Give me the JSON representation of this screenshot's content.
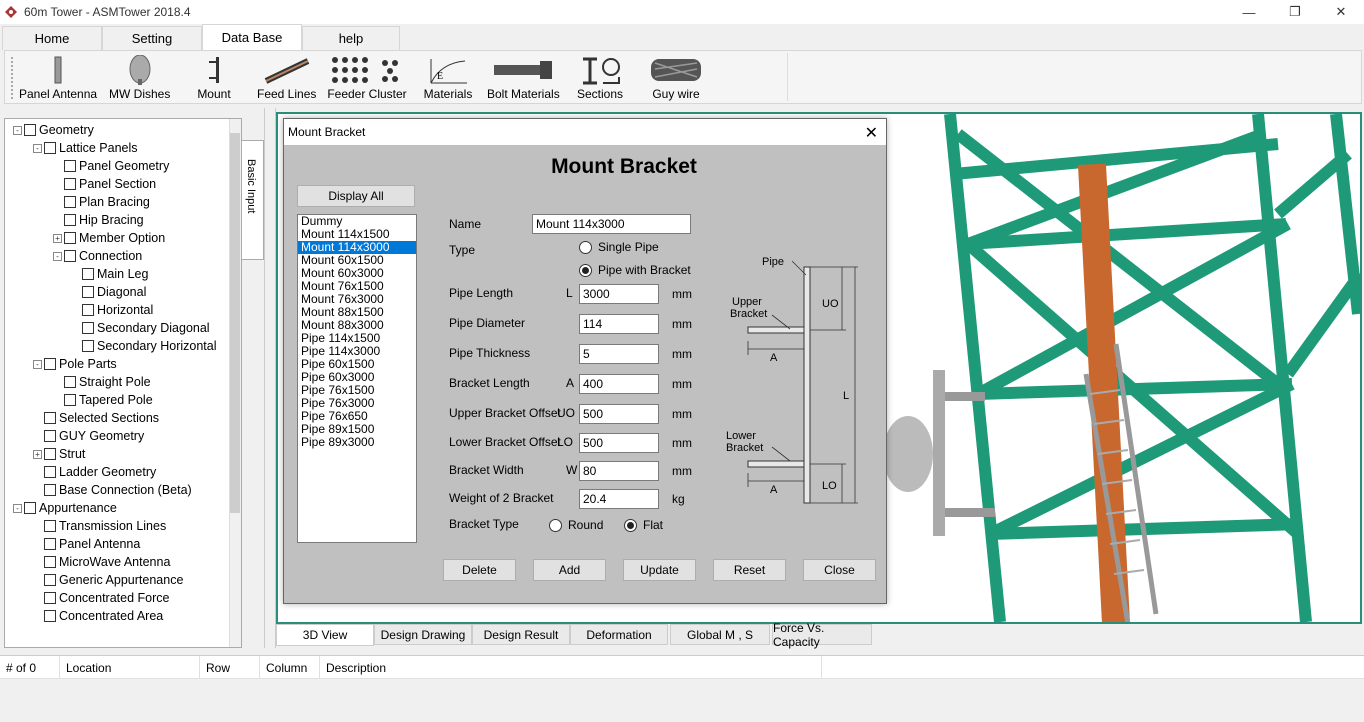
{
  "window": {
    "title": "60m  Tower - ASMTower 2018.4"
  },
  "ribbon_tabs": [
    "Home",
    "Setting",
    "Data Base",
    "help"
  ],
  "ribbon_items": [
    "Panel Antenna",
    "MW Dishes",
    "Mount",
    "Feed Lines",
    "Feeder Cluster",
    "Materials",
    "Bolt Materials",
    "Sections",
    "Guy wire"
  ],
  "tree": {
    "nodes": [
      "Geometry",
      "Lattice Panels",
      "Panel Geometry",
      "Panel Section",
      "Plan Bracing",
      "Hip Bracing",
      "Member Option",
      "Connection",
      "Main Leg",
      "Diagonal",
      "Horizontal",
      "Secondary Diagonal",
      "Secondary Horizontal",
      "Pole Parts",
      "Straight Pole",
      "Tapered Pole",
      "Selected Sections",
      "GUY Geometry",
      "Strut",
      "Ladder Geometry",
      "Base Connection (Beta)",
      "Appurtenance",
      "Transmission Lines",
      "Panel Antenna",
      "MicroWave Antenna",
      "Generic Appurtenance",
      "Concentrated Force",
      "Concentrated Area"
    ],
    "side_tab": "Basic Input"
  },
  "view_tabs": [
    "3D View",
    "Design Drawing",
    "Design Result",
    "Deformation",
    "Global M , S",
    "Force Vs. Capacity"
  ],
  "grid_headers": [
    "# of 0",
    "Location",
    "Row",
    "Column",
    "Description"
  ],
  "dialog": {
    "title": "Mount Bracket",
    "heading": "Mount Bracket",
    "display_all": "Display All",
    "list": [
      "Dummy",
      "Mount 114x1500",
      "Mount 114x3000",
      "Mount 60x1500",
      "Mount 60x3000",
      "Mount 76x1500",
      "Mount 76x3000",
      "Mount 88x1500",
      "Mount 88x3000",
      "Pipe 114x1500",
      "Pipe 114x3000",
      "Pipe 60x1500",
      "Pipe 60x3000",
      "Pipe 76x1500",
      "Pipe 76x3000",
      "Pipe 76x650",
      "Pipe 89x1500",
      "Pipe 89x3000"
    ],
    "selected_index": 2,
    "name_label": "Name",
    "name_value": "Mount 114x3000",
    "type_label": "Type",
    "type_options": [
      "Single Pipe",
      "Pipe with Bracket"
    ],
    "type_selected": "Pipe with Bracket",
    "fields": [
      {
        "label": "Pipe Length",
        "sym": "L",
        "value": "3000",
        "unit": "mm"
      },
      {
        "label": "Pipe Diameter",
        "sym": "",
        "value": "114",
        "unit": "mm"
      },
      {
        "label": "Pipe Thickness",
        "sym": "",
        "value": "5",
        "unit": "mm"
      },
      {
        "label": "Bracket Length",
        "sym": "A",
        "value": "400",
        "unit": "mm"
      },
      {
        "label": "Upper Bracket Offset",
        "sym": "UO",
        "value": "500",
        "unit": "mm"
      },
      {
        "label": "Lower Bracket Offset",
        "sym": "LO",
        "value": "500",
        "unit": "mm"
      },
      {
        "label": "Bracket Width",
        "sym": "W",
        "value": "80",
        "unit": "mm"
      },
      {
        "label": "Weight of 2 Bracket",
        "sym": "",
        "value": "20.4",
        "unit": "kg"
      }
    ],
    "bracket_type_label": "Bracket Type",
    "bracket_options": [
      "Round",
      "Flat"
    ],
    "bracket_selected": "Flat",
    "buttons": [
      "Delete",
      "Add",
      "Update",
      "Reset",
      "Close"
    ],
    "diagram_labels": {
      "pipe": "Pipe",
      "upper1": "Upper",
      "upper2": "Bracket",
      "lower1": "Lower",
      "lower2": "Bracket",
      "a": "A",
      "uo": "UO",
      "l": "L",
      "lo": "LO"
    }
  },
  "colors": {
    "tower": "#1f9a78",
    "pipe": "#c8682f",
    "selection": "#0078d7",
    "view_border": "#2a8f7a"
  }
}
